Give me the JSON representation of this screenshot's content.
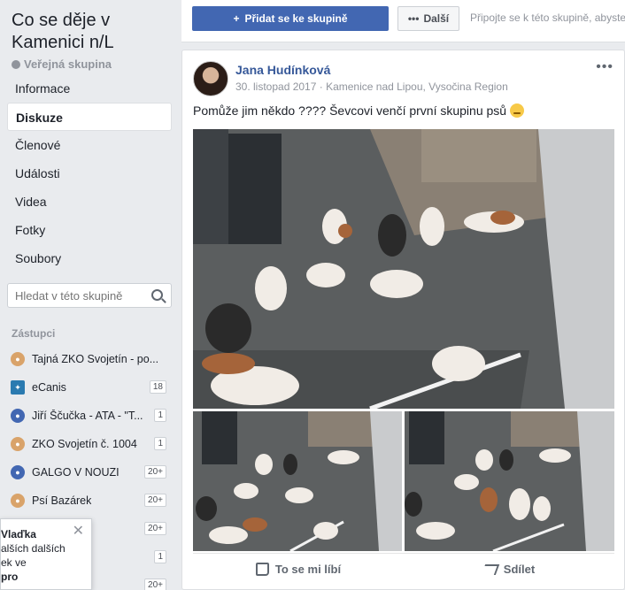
{
  "group": {
    "title": "Co se děje v Kamenici n/L",
    "privacy": "Veřejná skupina"
  },
  "nav": [
    {
      "label": "Informace",
      "active": false
    },
    {
      "label": "Diskuze",
      "active": true
    },
    {
      "label": "Členové",
      "active": false
    },
    {
      "label": "Události",
      "active": false
    },
    {
      "label": "Videa",
      "active": false
    },
    {
      "label": "Fotky",
      "active": false
    },
    {
      "label": "Soubory",
      "active": false
    }
  ],
  "search": {
    "placeholder": "Hledat v této skupině"
  },
  "shortcuts": {
    "label": "Zástupci",
    "items": [
      {
        "label": "Tajná ZKO Svojetín - po...",
        "badge": "",
        "icon": "paw-icon"
      },
      {
        "label": "eCanis",
        "badge": "18",
        "icon": "ecanis-icon"
      },
      {
        "label": "Jiří Ščučka - ATA - \"T...",
        "badge": "1",
        "icon": "group-icon"
      },
      {
        "label": "ZKO Svojetín č. 1004",
        "badge": "1",
        "icon": "paw-icon"
      },
      {
        "label": "GALGO V NOUZI",
        "badge": "20+",
        "icon": "group-icon"
      },
      {
        "label": "Psí Bazárek",
        "badge": "20+",
        "icon": "paw-icon"
      },
      {
        "label": "",
        "badge": "20+",
        "icon": "group-icon"
      },
      {
        "label": "",
        "badge": "1",
        "icon": "group-icon"
      },
      {
        "label": "",
        "badge": "20+",
        "icon": "group-icon"
      }
    ]
  },
  "popup": {
    "name": "Vlaďka",
    "line2": "alších dalších",
    "line3": "ek ve",
    "line4": "pro"
  },
  "topbar": {
    "join_label": "Přidat se ke skupině",
    "more_label": "Další",
    "hint": "Připojte se k této skupině, abyste"
  },
  "post": {
    "author": "Jana Hudínková",
    "date": "30. listopad 2017",
    "location": "Kamenice nad Lipou, Vysočina Region",
    "text": "Pomůže jim někdo ???? Ševcovi venčí první skupinu psů",
    "like_label": "To se mi líbí",
    "share_label": "Sdílet"
  },
  "colors": {
    "brand": "#4267b2",
    "link": "#365899",
    "page_bg": "#e9ebee"
  }
}
